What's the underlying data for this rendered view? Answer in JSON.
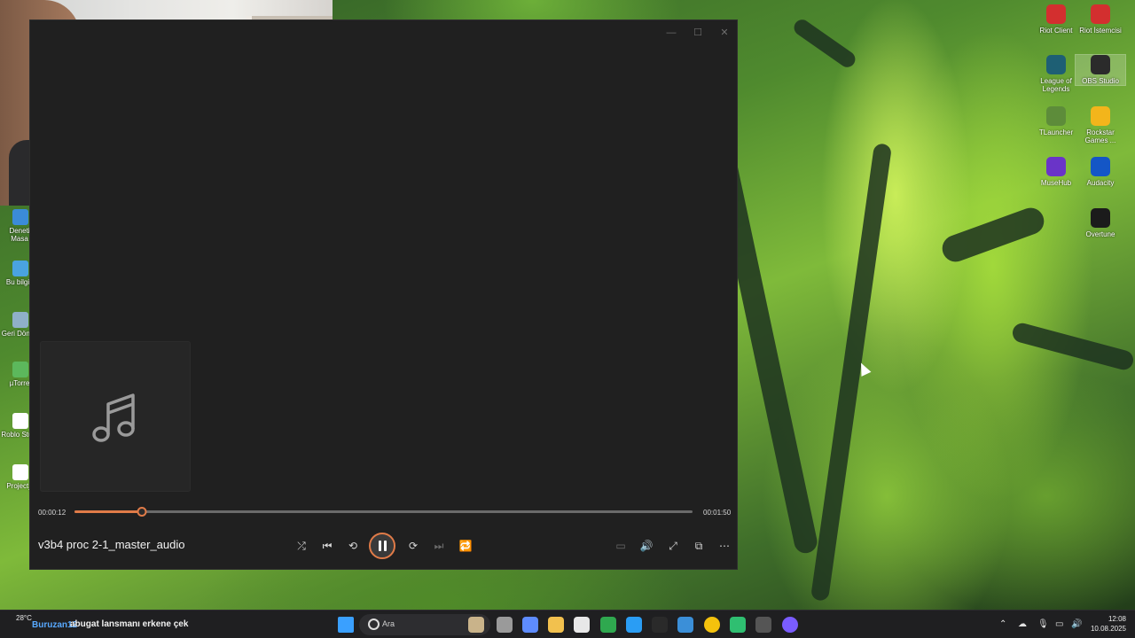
{
  "desktop": {
    "left_icons": [
      {
        "label": "Deneti Masa",
        "color": "#3b8bd8"
      },
      {
        "label": "Bu bilgis",
        "color": "#4aa3e0"
      },
      {
        "label": "Geri Dönüş",
        "color": "#8fb0c8"
      },
      {
        "label": "µTorre",
        "color": "#5cb85c"
      },
      {
        "label": "Roblo Studi",
        "color": "#ffffff"
      },
      {
        "label": "Project_",
        "color": "#ffffff"
      }
    ],
    "right_icons": [
      {
        "label": "Riot Client",
        "color": "#d32f2f"
      },
      {
        "label": "Riot İstemcisi",
        "color": "#d32f2f"
      },
      {
        "label": "League of Legends",
        "color": "#1e5f74"
      },
      {
        "label": "OBS Studio",
        "color": "#2b2b2b",
        "selected": true
      },
      {
        "label": "TLauncher",
        "color": "#5d8c3a"
      },
      {
        "label": "Rockstar Games ...",
        "color": "#f3b51b"
      },
      {
        "label": "MuseHub",
        "color": "#6a34c8"
      },
      {
        "label": "Audacity",
        "color": "#1456c6"
      },
      {
        "label": "Overtune",
        "color": "#1b1b1b"
      }
    ]
  },
  "player": {
    "window_controls": {
      "minimize": "—",
      "maximize": "☐",
      "close": "✕"
    },
    "album_art_icon": "music-note-icon",
    "elapsed": "00:00:12",
    "duration": "00:01:50",
    "progress_fraction": 0.109,
    "track_title": "v3b4 proc 2-1_master_audio",
    "accent_color": "#e07b48",
    "controls": {
      "shuffle": "⤮",
      "previous": "⏮",
      "rewind": "⟲",
      "forward": "⟳",
      "next": "⏭",
      "repeat": "🔁",
      "subtitles": "▭",
      "volume": "🔊",
      "fullscreen": "⤢",
      "miniplayer": "⧉",
      "more": "⋯"
    }
  },
  "taskbar": {
    "weather_temp": "28°C",
    "overlay_user": "Buruzan12",
    "ticker_text": "abugat lansmanı erkene çek",
    "search_placeholder": "Ara",
    "time": "12:08",
    "date": "10.08.2025",
    "apps": [
      {
        "name": "start-button",
        "color": "#3aa0ff"
      },
      {
        "name": "widgets-app",
        "color": "#c9b38a"
      },
      {
        "name": "task-view-app",
        "color": "#9a9a9a"
      },
      {
        "name": "copilot-app",
        "color": "#5e8cff"
      },
      {
        "name": "file-explorer-app",
        "color": "#f2c14e"
      },
      {
        "name": "store-app",
        "color": "#e8e8e8"
      },
      {
        "name": "xbox-app",
        "color": "#2fa84f"
      },
      {
        "name": "edge-app",
        "color": "#2a9df4"
      },
      {
        "name": "epic-games-app",
        "color": "#2a2a2a"
      },
      {
        "name": "vscode-app",
        "color": "#3b8fd8"
      },
      {
        "name": "chrome-app",
        "color": "#f4c20d"
      },
      {
        "name": "discord-app",
        "color": "#2fbf71"
      },
      {
        "name": "steam-app",
        "color": "#555"
      },
      {
        "name": "media-player-app",
        "color": "#7a5cff"
      }
    ]
  }
}
